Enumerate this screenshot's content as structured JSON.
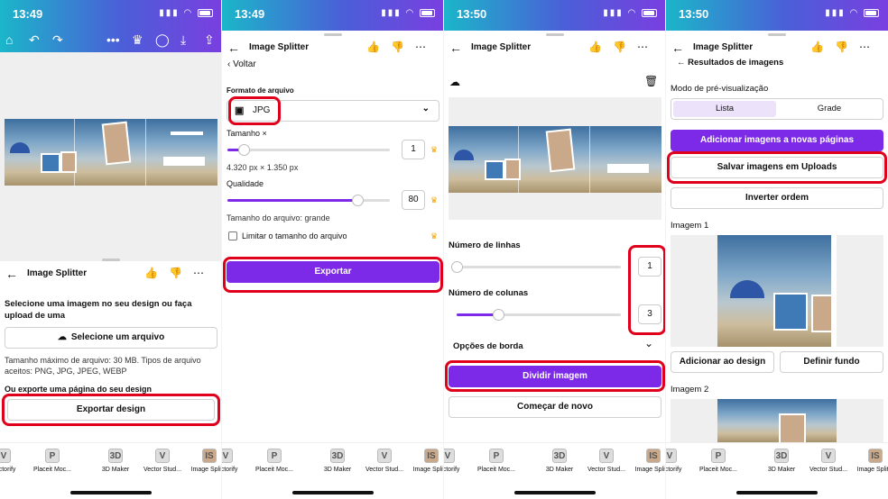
{
  "phone1": {
    "time": "13:49",
    "panel_title": "Image Splitter",
    "instruction": "Selecione uma imagem no seu design ou faça upload de uma",
    "select_file_label": "Selecione um arquivo",
    "file_limits": "Tamanho máximo de arquivo: 30 MB. Tipos de arquivo aceitos: PNG, JPG, JPEG, WEBP",
    "export_hint": "Ou exporte uma página do seu design",
    "export_design_label": "Exportar design"
  },
  "phone2": {
    "time": "13:49",
    "panel_title": "Image Splitter",
    "back_label": "Voltar",
    "format_label": "Formato de arquivo",
    "format_value": "JPG",
    "size_label": "Tamanho ×",
    "size_value": "1",
    "dimensions": "4.320 px × 1.350 px",
    "quality_label": "Qualidade",
    "quality_value": "80",
    "file_size_note": "Tamanho do arquivo: grande",
    "limit_label": "Limitar o tamanho do arquivo",
    "export_label": "Exportar",
    "size_slider": 0.1,
    "quality_slider": 0.8
  },
  "phone3": {
    "time": "13:50",
    "panel_title": "Image Splitter",
    "rows_label": "Número de linhas",
    "rows_value": "1",
    "cols_label": "Número de colunas",
    "cols_value": "3",
    "border_options_label": "Opções de borda",
    "split_label": "Dividir imagem",
    "restart_label": "Começar de novo",
    "rows_slider": 0.0,
    "cols_slider": 0.25
  },
  "phone4": {
    "time": "13:50",
    "panel_title": "Image Splitter",
    "results_label": "Resultados de imagens",
    "preview_mode_label": "Modo de pré-visualização",
    "list_label": "Lista",
    "grid_label": "Grade",
    "add_pages_label": "Adicionar imagens a novas páginas",
    "save_uploads_label": "Salvar imagens em Uploads",
    "invert_label": "Inverter ordem",
    "image1_label": "Imagem 1",
    "add_design_label": "Adicionar ao design",
    "set_bg_label": "Definir fundo",
    "image2_label": "Imagem 2"
  },
  "apps": [
    "Vectorify",
    "Placeit Moc...",
    "3D Maker",
    "Vector Stud...",
    "Image Split..."
  ],
  "app_initials": [
    "V",
    "P",
    "3D",
    "V",
    "IS"
  ],
  "colors": {
    "accent": "#7d2ae8",
    "highlight": "#e0001b",
    "crown": "#f2a500"
  }
}
